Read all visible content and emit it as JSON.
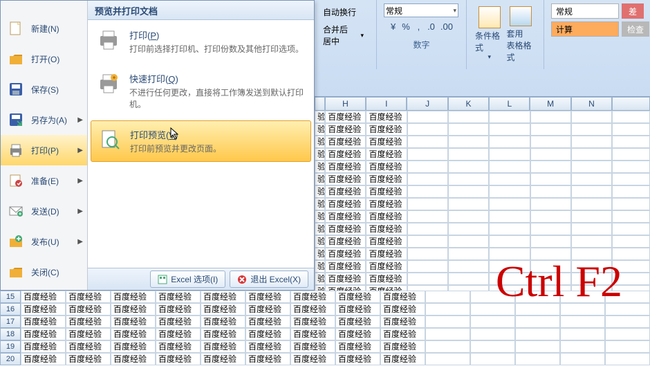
{
  "ribbon": {
    "auto_wrap": "自动换行",
    "merge_center": "合并后居中",
    "number_format": "常规",
    "number_label": "数字",
    "cond_format": "条件格式",
    "table_format": "套用\n表格格式",
    "style_normal": "常规",
    "style_calc": "计算",
    "style_bad": "差",
    "style_check": "检查"
  },
  "menu": {
    "items": [
      {
        "label": "新建(N)"
      },
      {
        "label": "打开(O)"
      },
      {
        "label": "保存(S)"
      },
      {
        "label": "另存为(A)"
      },
      {
        "label": "打印(P)"
      },
      {
        "label": "准备(E)"
      },
      {
        "label": "发送(D)"
      },
      {
        "label": "发布(U)"
      },
      {
        "label": "关闭(C)"
      }
    ],
    "panel_title": "预览并打印文档",
    "print_opts": [
      {
        "title": "打印(P)",
        "desc": "打印前选择打印机、打印份数及其他打印选项。"
      },
      {
        "title": "快速打印(Q)",
        "desc": "不进行任何更改，直接将工作簿发送到默认打印机。"
      },
      {
        "title": "打印预览(V)",
        "desc": "打印前预览并更改页面。"
      }
    ],
    "footer": {
      "options": "Excel 选项(I)",
      "exit": "退出 Excel(X)"
    }
  },
  "sheet": {
    "cell_value": "百度经验",
    "cols_right": [
      "H",
      "I",
      "J",
      "K",
      "L",
      "M",
      "N"
    ],
    "rows_bottom": [
      "15",
      "16",
      "17",
      "18",
      "19",
      "20"
    ]
  },
  "shortcut": "Ctrl F2"
}
